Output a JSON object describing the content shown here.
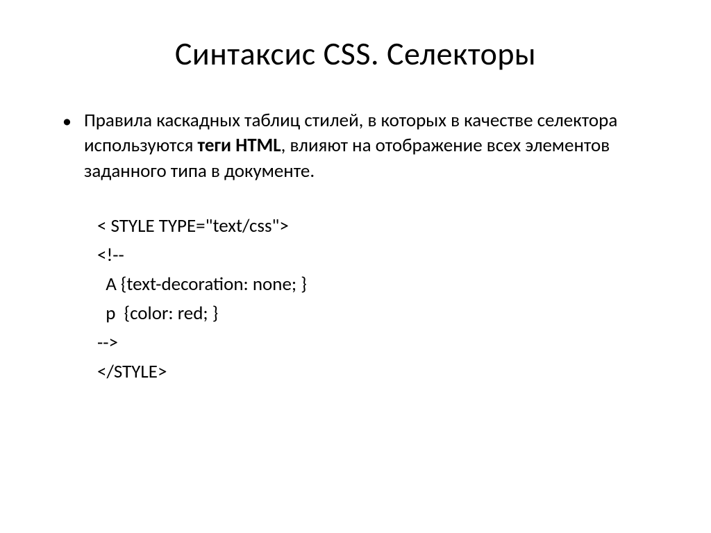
{
  "title": "Синтаксис CSS. Селекторы",
  "bullet": {
    "marker": "•",
    "text_part1": "Правила каскадных таблиц стилей, в которых в качестве селектора используются ",
    "text_bold": "теги HTML",
    "text_part2": ", влияют на отображение всех элементов заданного типа в документе."
  },
  "code": {
    "line1": "< STYLE TYPE=\"text/css\">",
    "line2": "<!--",
    "line3": "  A {text-decoration: none; }",
    "line4": "  p  {color: red; }",
    "line5": "-->",
    "line6": "</STYLE>"
  }
}
